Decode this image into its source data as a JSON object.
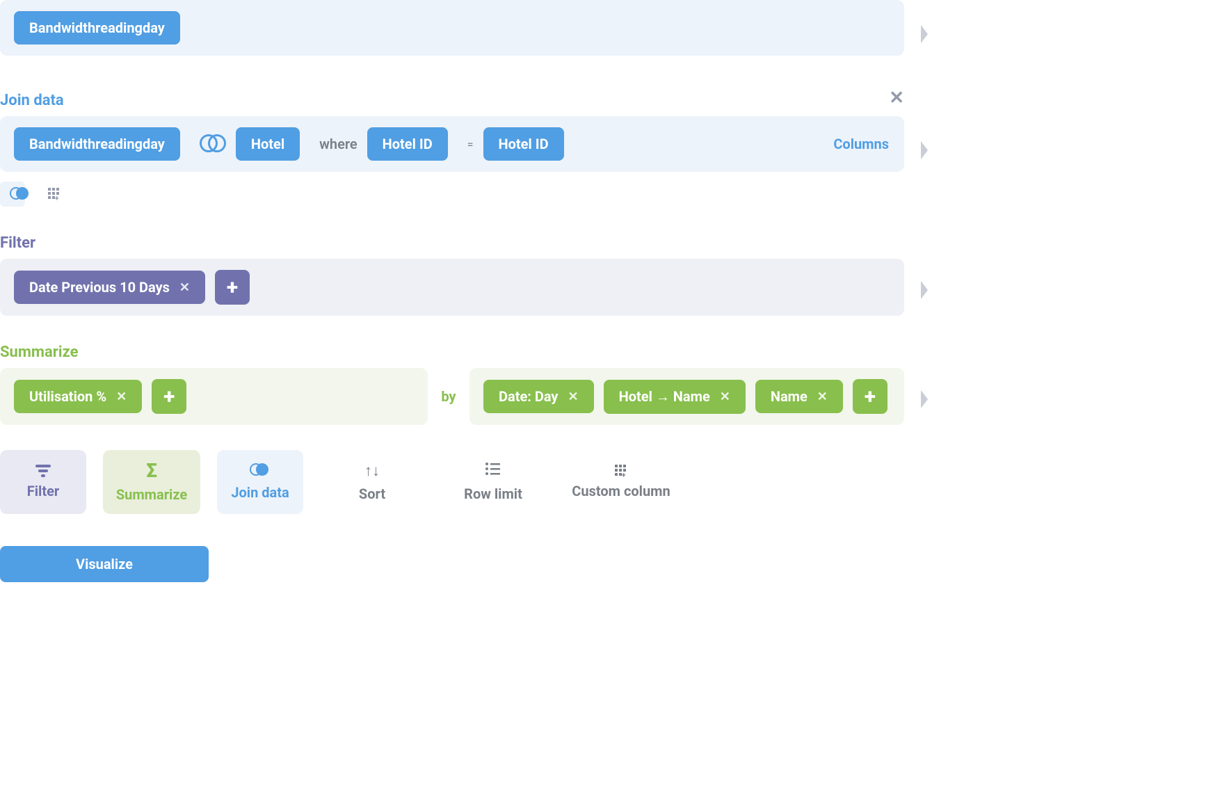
{
  "data": {
    "source_table": "Bandwidthreadingday"
  },
  "join": {
    "section_label": "Join data",
    "left_table": "Bandwidthreadingday",
    "right_table": "Hotel",
    "where_label": "where",
    "left_key": "Hotel ID",
    "equals_label": "=",
    "right_key": "Hotel ID",
    "columns_link": "Columns"
  },
  "filter": {
    "section_label": "Filter",
    "chips": [
      {
        "label": "Date Previous 10 Days"
      }
    ]
  },
  "summarize": {
    "section_label": "Summarize",
    "aggregates": [
      {
        "label": "Utilisation %"
      }
    ],
    "by_label": "by",
    "groups": [
      {
        "label": "Date: Day"
      },
      {
        "label": "Hotel → Name"
      },
      {
        "label": "Name"
      }
    ]
  },
  "actions": {
    "filter": "Filter",
    "summarize": "Summarize",
    "join": "Join data",
    "sort": "Sort",
    "row_limit": "Row limit",
    "custom_column": "Custom column"
  },
  "visualize_label": "Visualize"
}
